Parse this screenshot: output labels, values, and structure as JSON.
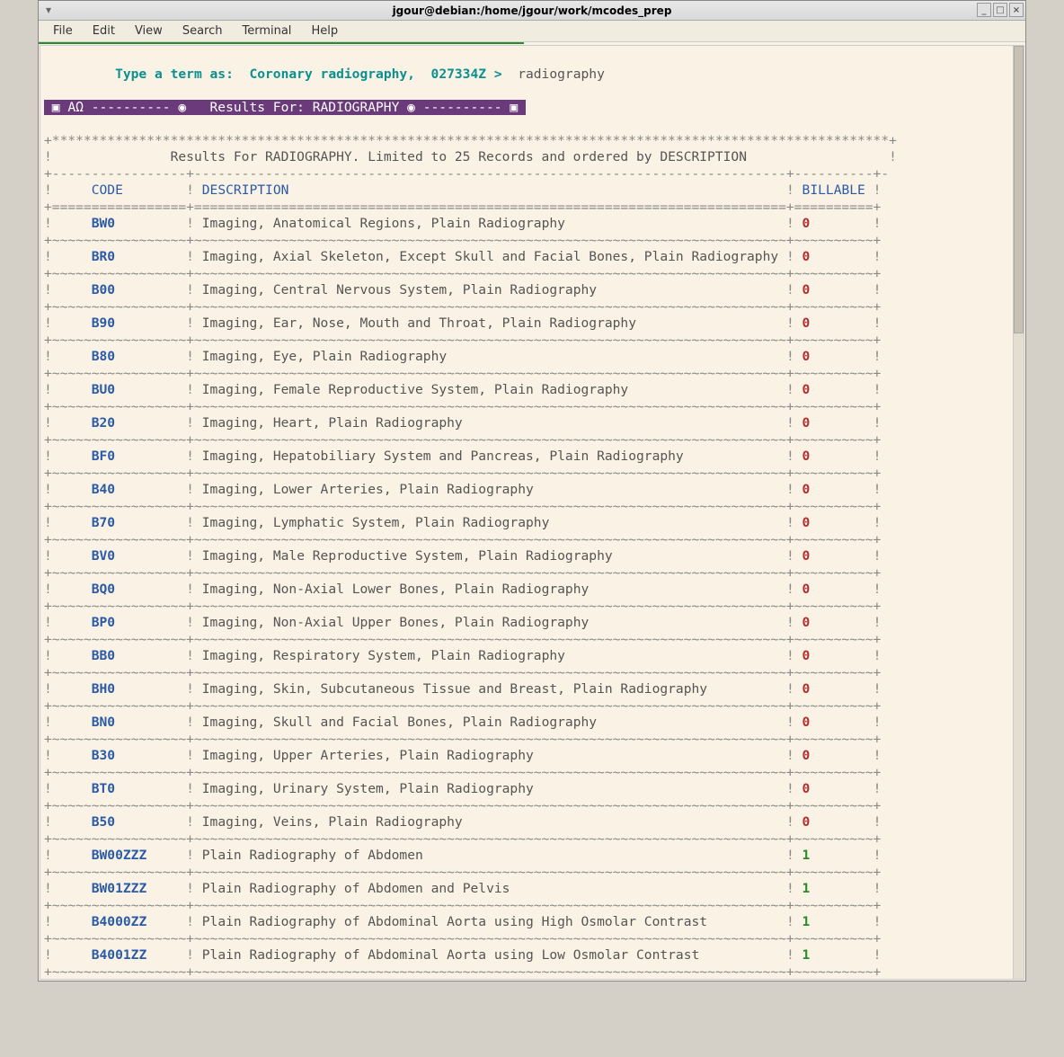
{
  "title": "jgour@debian:/home/jgour/work/mcodes_prep",
  "menu": {
    "file": "File",
    "edit": "Edit",
    "view": "View",
    "search": "Search",
    "terminal": "Terminal",
    "help": "Help"
  },
  "prompt": {
    "label": "Type a term as:",
    "example": "Coronary radiography,  027334Z >",
    "input": "radiography"
  },
  "banner": {
    "symL": "▣",
    "ao": "AΩ",
    "d1": "----------",
    "bullet": "◉",
    "text": "Results For: RADIOGRAPHY",
    "d2": "----------",
    "symR": "▣"
  },
  "summary": "Results For RADIOGRAPHY. Limited to 25 Records and ordered by DESCRIPTION",
  "headers": {
    "code": "CODE",
    "desc": "DESCRIPTION",
    "bill": "BILLABLE"
  },
  "rows": [
    {
      "code": "BW0",
      "desc": "Imaging, Anatomical Regions, Plain Radiography",
      "bill": "0"
    },
    {
      "code": "BR0",
      "desc": "Imaging, Axial Skeleton, Except Skull and Facial Bones, Plain Radiography",
      "bill": "0"
    },
    {
      "code": "B00",
      "desc": "Imaging, Central Nervous System, Plain Radiography",
      "bill": "0"
    },
    {
      "code": "B90",
      "desc": "Imaging, Ear, Nose, Mouth and Throat, Plain Radiography",
      "bill": "0"
    },
    {
      "code": "B80",
      "desc": "Imaging, Eye, Plain Radiography",
      "bill": "0"
    },
    {
      "code": "BU0",
      "desc": "Imaging, Female Reproductive System, Plain Radiography",
      "bill": "0"
    },
    {
      "code": "B20",
      "desc": "Imaging, Heart, Plain Radiography",
      "bill": "0"
    },
    {
      "code": "BF0",
      "desc": "Imaging, Hepatobiliary System and Pancreas, Plain Radiography",
      "bill": "0"
    },
    {
      "code": "B40",
      "desc": "Imaging, Lower Arteries, Plain Radiography",
      "bill": "0"
    },
    {
      "code": "B70",
      "desc": "Imaging, Lymphatic System, Plain Radiography",
      "bill": "0"
    },
    {
      "code": "BV0",
      "desc": "Imaging, Male Reproductive System, Plain Radiography",
      "bill": "0"
    },
    {
      "code": "BQ0",
      "desc": "Imaging, Non-Axial Lower Bones, Plain Radiography",
      "bill": "0"
    },
    {
      "code": "BP0",
      "desc": "Imaging, Non-Axial Upper Bones, Plain Radiography",
      "bill": "0"
    },
    {
      "code": "BB0",
      "desc": "Imaging, Respiratory System, Plain Radiography",
      "bill": "0"
    },
    {
      "code": "BH0",
      "desc": "Imaging, Skin, Subcutaneous Tissue and Breast, Plain Radiography",
      "bill": "0"
    },
    {
      "code": "BN0",
      "desc": "Imaging, Skull and Facial Bones, Plain Radiography",
      "bill": "0"
    },
    {
      "code": "B30",
      "desc": "Imaging, Upper Arteries, Plain Radiography",
      "bill": "0"
    },
    {
      "code": "BT0",
      "desc": "Imaging, Urinary System, Plain Radiography",
      "bill": "0"
    },
    {
      "code": "B50",
      "desc": "Imaging, Veins, Plain Radiography",
      "bill": "0"
    },
    {
      "code": "BW00ZZZ",
      "desc": "Plain Radiography of Abdomen",
      "bill": "1"
    },
    {
      "code": "BW01ZZZ",
      "desc": "Plain Radiography of Abdomen and Pelvis",
      "bill": "1"
    },
    {
      "code": "B4000ZZ",
      "desc": "Plain Radiography of Abdominal Aorta using High Osmolar Contrast",
      "bill": "1"
    },
    {
      "code": "B4001ZZ",
      "desc": "Plain Radiography of Abdominal Aorta using Low Osmolar Contrast",
      "bill": "1"
    }
  ]
}
